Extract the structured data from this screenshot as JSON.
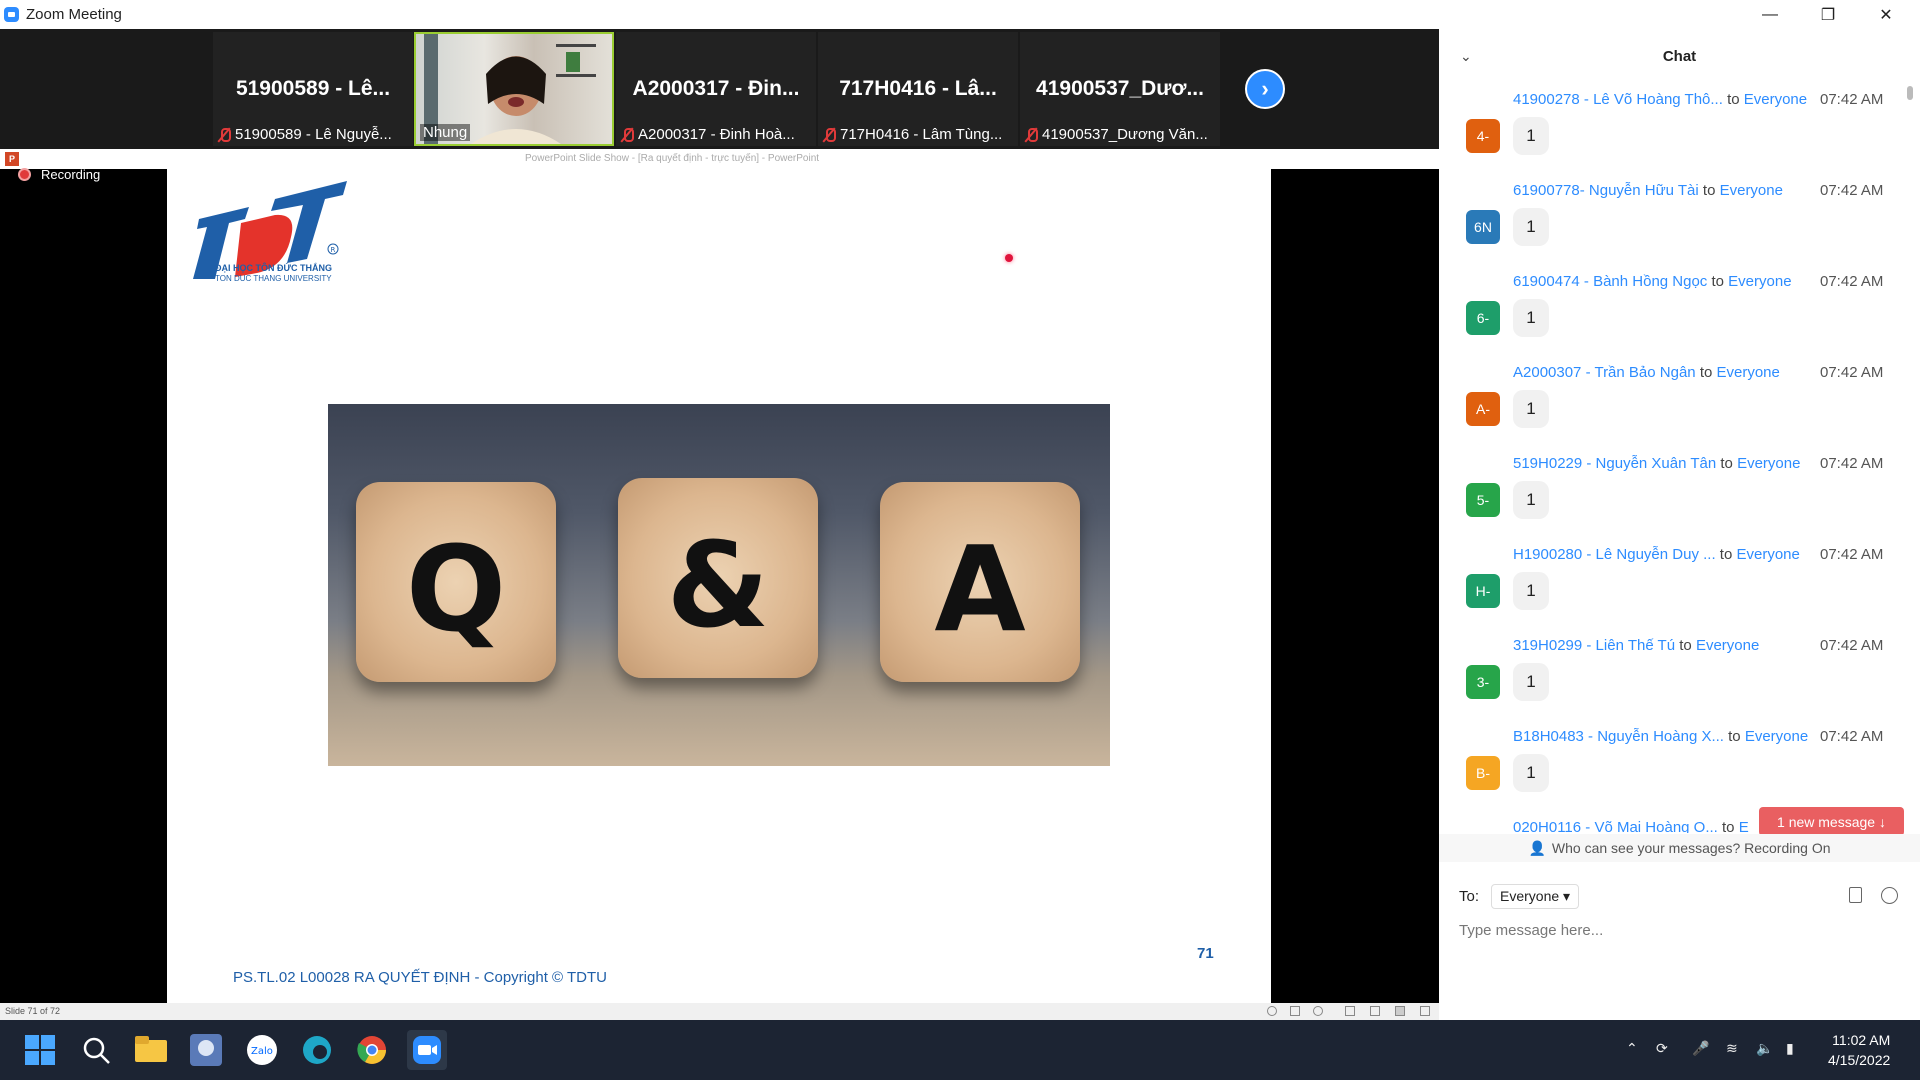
{
  "window": {
    "title": "Zoom Meeting"
  },
  "strip": {
    "tiles": [
      {
        "big": "51900589 - Lê...",
        "small": "51900589 - Lê Nguyễ..."
      },
      {
        "big": "",
        "small": "Nhung"
      },
      {
        "big": "A2000317 - Đin...",
        "small": "A2000317 - Đinh Hoà..."
      },
      {
        "big": "717H0416 - Lâ...",
        "small": "717H0416 - Lâm Tùng..."
      },
      {
        "big": "41900537_Dươ...",
        "small": "41900537_Dương Văn..."
      }
    ]
  },
  "ppt": {
    "caption": "PowerPoint Slide Show - [Ra quyết định - trực tuyến] - PowerPoint",
    "status": "Slide 71 of 72"
  },
  "recording": {
    "label": "Recording"
  },
  "slide": {
    "logo_line1": "ĐẠI HỌC TÔN ĐỨC THẮNG",
    "logo_line2": "TON DUC THANG UNIVERSITY",
    "cube_letters": [
      "Q",
      "&",
      "A"
    ],
    "page_number": "71",
    "footer": "PS.TL.02 L00028 RA QUYẾT ĐỊNH - Copyright © TDTU"
  },
  "chat": {
    "title": "Chat",
    "messages": [
      {
        "avatar": "4-",
        "color": "#e0600f",
        "from": "41900278 - Lê Võ Hoàng Thô...",
        "to": "to",
        "recipient": "Everyone",
        "time": "07:42 AM",
        "text": "1"
      },
      {
        "avatar": "6N",
        "color": "#2a7ab8",
        "from": "61900778- Nguyễn Hữu Tài",
        "to": "to",
        "recipient": "Everyone",
        "time": "07:42 AM",
        "text": "1"
      },
      {
        "avatar": "6-",
        "color": "#1e9e6a",
        "from": "61900474 - Bành Hồng Ngọc",
        "to": "to",
        "recipient": "Everyone",
        "time": "07:42 AM",
        "text": "1"
      },
      {
        "avatar": "A-",
        "color": "#e0600f",
        "from": "A2000307 - Trần Bảo Ngân",
        "to": "to",
        "recipient": "Everyone",
        "time": "07:42 AM",
        "text": "1"
      },
      {
        "avatar": "5-",
        "color": "#27a54a",
        "from": "519H0229 - Nguyễn Xuân Tân",
        "to": "to",
        "recipient": "Everyone",
        "time": "07:42 AM",
        "text": "1"
      },
      {
        "avatar": "H-",
        "color": "#1e9e6a",
        "from": "H1900280 - Lê Nguyễn Duy ...",
        "to": "to",
        "recipient": "Everyone",
        "time": "07:42 AM",
        "text": "1"
      },
      {
        "avatar": "3-",
        "color": "#27a54a",
        "from": "319H0299 - Liên Thế Tú",
        "to": "to",
        "recipient": "Everyone",
        "time": "07:42 AM",
        "text": "1"
      },
      {
        "avatar": "B-",
        "color": "#f5a623",
        "from": "B18H0483 - Nguyễn Hoàng X...",
        "to": "to",
        "recipient": "Everyone",
        "time": "07:42 AM",
        "text": "1"
      },
      {
        "avatar": "",
        "color": "#ffffff",
        "from": "020H0116 - Võ Mai Hoàng O...",
        "to": "to",
        "recipient": "E",
        "time": "",
        "text": ""
      }
    ],
    "new_message": "1 new message",
    "privacy": "Who can see your messages? Recording On",
    "to_label": "To:",
    "to_value": "Everyone",
    "placeholder": "Type message here..."
  },
  "taskbar": {
    "time": "11:02 AM",
    "date": "4/15/2022"
  }
}
